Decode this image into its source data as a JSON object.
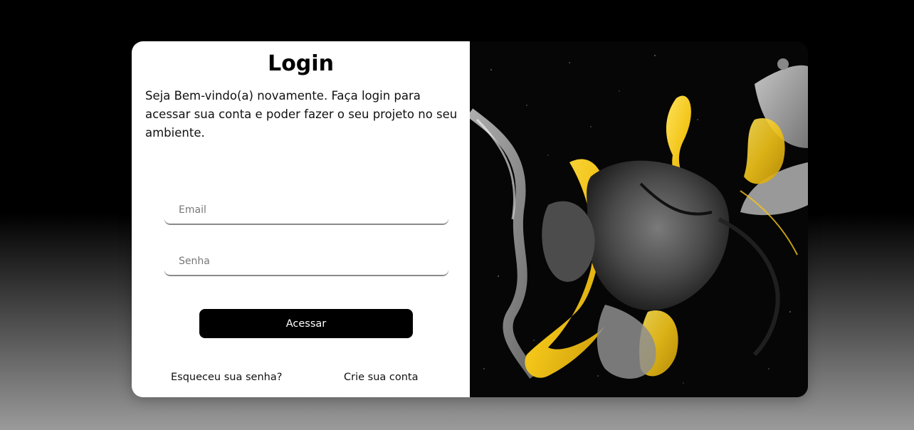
{
  "login": {
    "title": "Login",
    "intro": "Seja Bem-vindo(a) novamente. Faça login para acessar sua conta e poder fazer o seu projeto no seu ambiente.",
    "email_placeholder": "Email",
    "senha_placeholder": "Senha",
    "submit_label": "Acessar",
    "forgot_label": "Esqueceu sua senha?",
    "create_label": "Crie sua conta"
  },
  "colors": {
    "button_bg": "#000000",
    "art_gold": "#f2c418",
    "art_gray": "#8c8c8c"
  }
}
